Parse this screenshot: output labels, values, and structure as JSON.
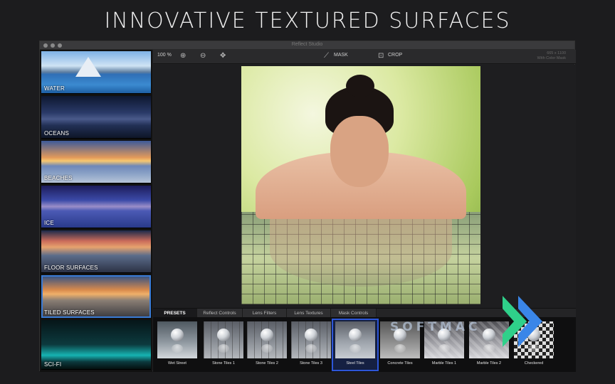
{
  "headline": "INNOVATIVE TEXTURED SURFACES",
  "window": {
    "title": "Reflect Studio"
  },
  "sidebar": {
    "categories": [
      {
        "label": "WATER"
      },
      {
        "label": "OCEANS"
      },
      {
        "label": "BEACHES"
      },
      {
        "label": "ICE"
      },
      {
        "label": "FLOOR SURFACES"
      },
      {
        "label": "TILED SURFACES",
        "selected": true
      },
      {
        "label": "SCI-FI"
      }
    ]
  },
  "toolbar": {
    "zoom": "100 %",
    "zoom_in_icon": "zoom-in-icon",
    "zoom_out_icon": "zoom-out-icon",
    "move_icon": "move-icon",
    "mask_label": "MASK",
    "crop_label": "CROP",
    "image_info_line1": "665 x 1100",
    "image_info_line2": "With Color Mask"
  },
  "tabs": [
    "PRESETS",
    "Reflect Controls",
    "Lens Filters",
    "Lens Textures",
    "Mask Controls"
  ],
  "active_tab": "PRESETS",
  "presets": [
    {
      "label": "Wet Street"
    },
    {
      "label": "Stone Tiles 1"
    },
    {
      "label": "Stone Tiles 2"
    },
    {
      "label": "Stone Tiles 3"
    },
    {
      "label": "Steel Tiles",
      "selected": true
    },
    {
      "label": "Concrete Tiles"
    },
    {
      "label": "Marble Tiles 1"
    },
    {
      "label": "Marble Tiles 2"
    },
    {
      "label": "Checkered"
    }
  ],
  "watermark": "SOFTMAC",
  "colors": {
    "selection": "#2d56d8",
    "logo_blue": "#3a86e8",
    "logo_green": "#2fd08a"
  }
}
